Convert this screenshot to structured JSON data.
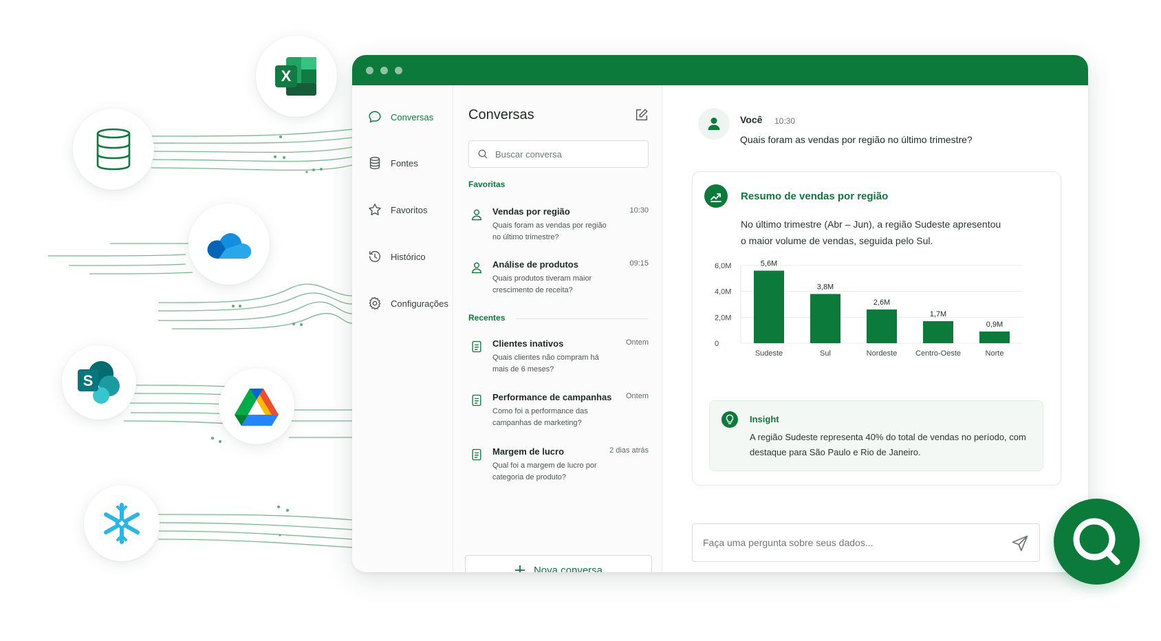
{
  "colors": {
    "brand": "#0b7a3a",
    "accent_light": "#f3f8f4",
    "excel": "#107c41",
    "onedrive": "#0f78d4",
    "sharepoint": "#036c70",
    "snowflake": "#29b5e8"
  },
  "sources": [
    {
      "icon": "excel-icon",
      "letter": "X"
    },
    {
      "icon": "database-icon"
    },
    {
      "icon": "onedrive-icon"
    },
    {
      "icon": "sharepoint-icon",
      "letter": "S"
    },
    {
      "icon": "google-drive-icon"
    },
    {
      "icon": "snowflake-icon"
    }
  ],
  "nav": [
    {
      "label": "Conversas",
      "icon": "chat-icon",
      "active": true
    },
    {
      "label": "Fontes",
      "icon": "database-icon"
    },
    {
      "label": "Favoritos",
      "icon": "star-icon"
    },
    {
      "label": "Histórico",
      "icon": "history-icon"
    },
    {
      "label": "Configurações",
      "icon": "gear-icon"
    }
  ],
  "conversations": {
    "title": "Conversas",
    "search_placeholder": "Buscar conversa",
    "favorites_label": "Favoritas",
    "recent_label": "Recentes",
    "favorites": [
      {
        "title": "Vendas por região",
        "time": "10:30",
        "desc": "Quais foram as vendas por região no último trimestre?",
        "icon": "user-icon"
      },
      {
        "title": "Análise de produtos",
        "time": "09:15",
        "desc": "Quais produtos tiveram maior crescimento de receita?",
        "icon": "user-icon"
      }
    ],
    "recent": [
      {
        "title": "Clientes inativos",
        "time": "Ontem",
        "desc": "Quais clientes não compram há mais de 6 meses?",
        "icon": "document-icon"
      },
      {
        "title": "Performance de campanhas",
        "time": "Ontem",
        "desc": "Como foi a performance das campanhas de marketing?",
        "icon": "document-icon"
      },
      {
        "title": "Margem de lucro",
        "time": "2 dias atrás",
        "desc": "Qual foi a margem de lucro por categoria de produto?",
        "icon": "document-icon"
      }
    ],
    "new_label": "Nova conversa"
  },
  "chat": {
    "user_name": "Você",
    "time": "10:30",
    "question": "Quais foram as vendas por região no último trimestre?",
    "card_title": "Resumo de vendas por região",
    "card_text": "No último trimestre (Abr – Jun), a região Sudeste apresentou o maior volume de vendas, seguida pelo Sul.",
    "insight_title": "Insight",
    "insight_text": "A região Sudeste representa 40% do total de vendas no período, com destaque para São Paulo e Rio de Janeiro.",
    "ask_placeholder": "Faça uma pergunta sobre seus dados..."
  },
  "chart_data": {
    "type": "bar",
    "categories": [
      "Sudeste",
      "Sul",
      "Nordeste",
      "Centro-Oeste",
      "Norte"
    ],
    "values": [
      5.6,
      3.8,
      2.6,
      1.7,
      0.9
    ],
    "value_labels": [
      "5,6M",
      "3,8M",
      "2,6M",
      "1,7M",
      "0,9M"
    ],
    "yticks": [
      0,
      2,
      4,
      6
    ],
    "ytick_labels": [
      "0",
      "2,0M",
      "4,0M",
      "6,0M"
    ],
    "ylim": [
      0,
      6
    ],
    "grid": true,
    "color": "#0b7a3a"
  }
}
